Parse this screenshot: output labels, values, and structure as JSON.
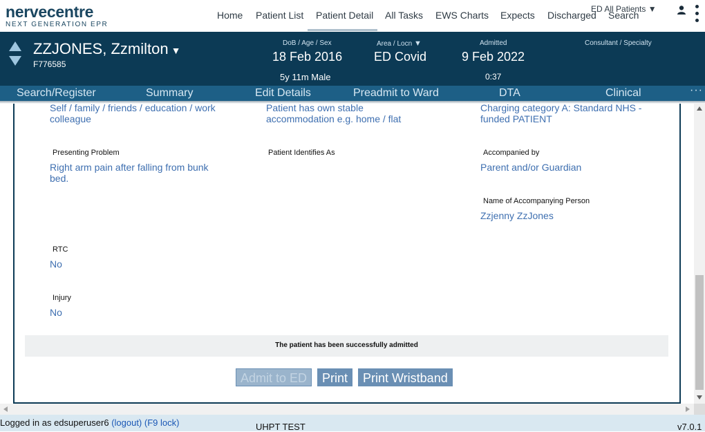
{
  "brand": {
    "name": "nervecentre",
    "tagline": "NEXT GENERATION EPR"
  },
  "nav": {
    "items": [
      "Home",
      "Patient List",
      "Patient Detail",
      "All Tasks",
      "EWS Charts",
      "Expects",
      "Discharged",
      "Search"
    ],
    "active": "Patient Detail",
    "ward_filter": "ED All Patients"
  },
  "patient": {
    "name": "ZZJONES, Zzmilton",
    "id": "F776585",
    "dob_label": "DoB / Age / Sex",
    "dob": "18 Feb 2016",
    "age_sex": "5y 11m Male",
    "area_label": "Area / Locn",
    "area": "ED Covid",
    "admitted_label": "Admitted",
    "admitted": "9 Feb 2022",
    "admitted_time": "0:37",
    "consultant_label": "Consultant / Specialty"
  },
  "subnav": {
    "items": [
      "Search/Register",
      "Summary",
      "Edit Details",
      "Preadmit to Ward",
      "DTA",
      "Clinical"
    ],
    "more": "···"
  },
  "form": {
    "referral_val": "Self / family / friends / education / work colleague",
    "accommodation_val": "Patient has own stable accommodation e.g. home / flat",
    "charging_val": "Charging category A: Standard NHS - funded PATIENT",
    "presenting_label": "Presenting Problem",
    "presenting_val": "Right arm pain after falling from bunk bed.",
    "identifies_label": "Patient Identifies As",
    "accompanied_label": "Accompanied by",
    "accompanied_val": "Parent and/or Guardian",
    "acc_person_label": "Name of Accompanying Person",
    "acc_person_val": "Zzjenny ZzJones",
    "rtc_label": "RTC",
    "rtc_val": "No",
    "injury_label": "Injury",
    "injury_val": "No"
  },
  "notice": "The patient has been successfully admitted",
  "buttons": {
    "admit": "Admit to ED",
    "print": "Print",
    "wristband": "Print Wristband"
  },
  "footer": {
    "logged_in": "Logged in as edsuperuser6",
    "logout": "(logout)",
    "f9": "(F9 lock)",
    "env": "UHPT TEST",
    "version": "v7.0.1"
  },
  "colors": {
    "header_bg": "#0c3a55",
    "subnav_bg": "#1d5f86",
    "value_text": "#3e6fb0",
    "footer_bg": "#d9e8f1"
  }
}
